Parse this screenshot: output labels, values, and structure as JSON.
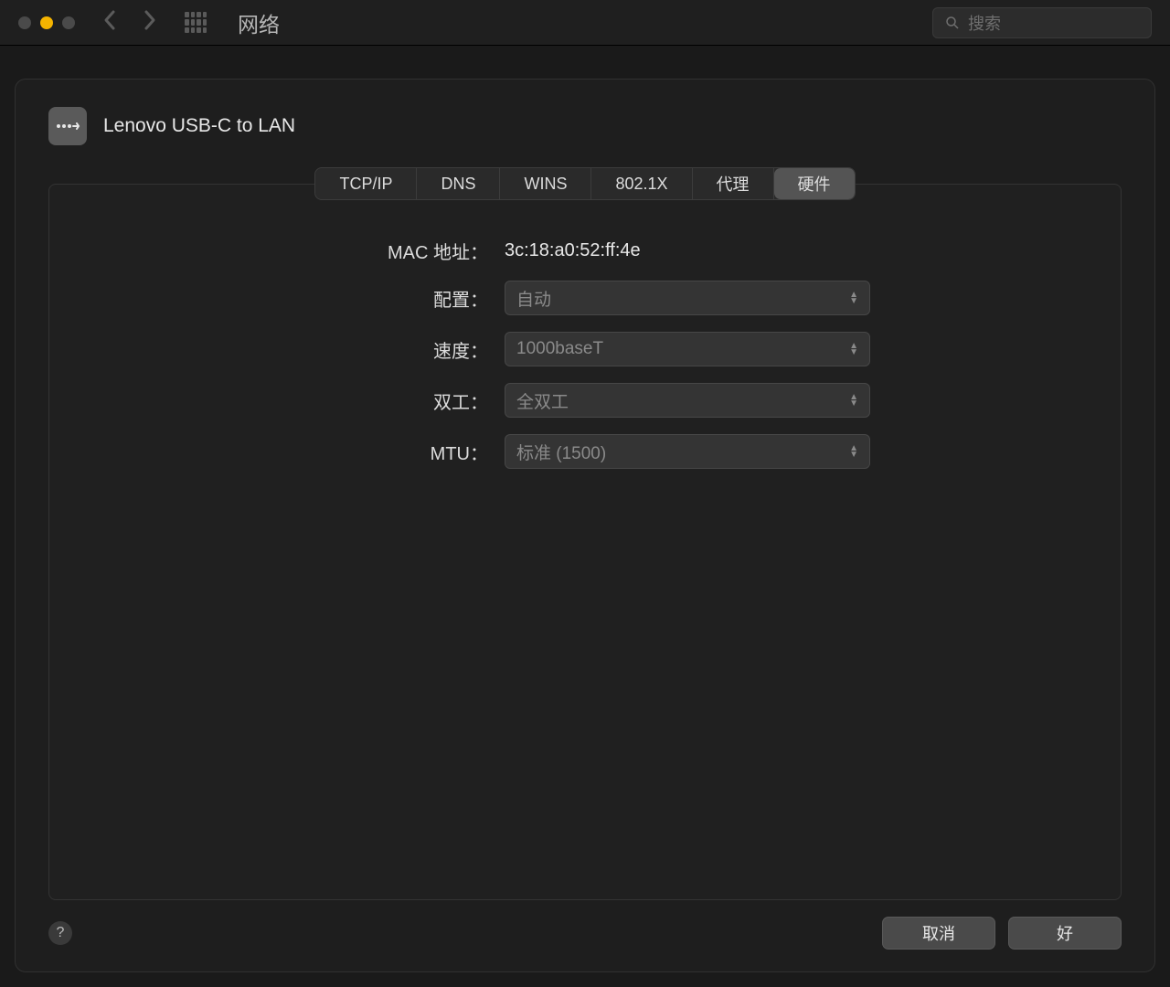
{
  "window": {
    "title": "网络",
    "search_placeholder": "搜索"
  },
  "device": {
    "name": "Lenovo USB-C to LAN"
  },
  "tabs": [
    {
      "label": "TCP/IP",
      "active": false
    },
    {
      "label": "DNS",
      "active": false
    },
    {
      "label": "WINS",
      "active": false
    },
    {
      "label": "802.1X",
      "active": false
    },
    {
      "label": "代理",
      "active": false
    },
    {
      "label": "硬件",
      "active": true
    }
  ],
  "hardware": {
    "mac_label": "MAC 地址：",
    "mac_value": "3c:18:a0:52:ff:4e",
    "config_label": "配置：",
    "config_value": "自动",
    "speed_label": "速度：",
    "speed_value": "1000baseT",
    "duplex_label": "双工：",
    "duplex_value": "全双工",
    "mtu_label": "MTU：",
    "mtu_value": "标准 (1500)"
  },
  "footer": {
    "cancel": "取消",
    "ok": "好"
  }
}
